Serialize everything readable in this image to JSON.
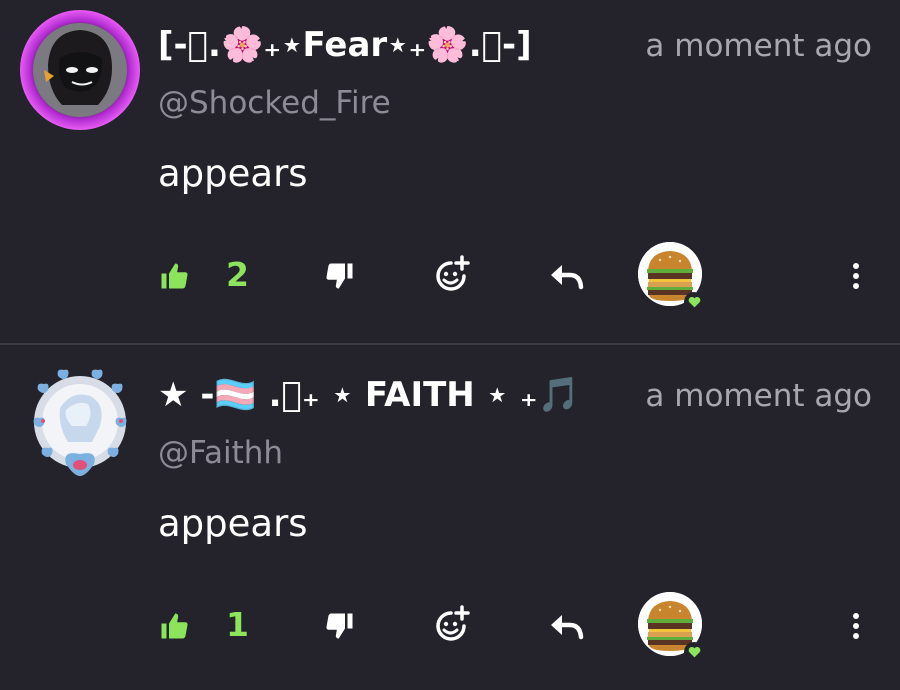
{
  "comments": [
    {
      "display_name": "[-⃟.🌸₊⋆Fear⋆₊🌸.⃟-]",
      "handle": "@Shocked_Fire",
      "timestamp": "a moment ago",
      "body": "appears",
      "like_count": "2",
      "avatar_icon": "dark-character-avatar-icon",
      "reactor_icon": "burger-avatar-icon"
    },
    {
      "display_name": "★ -🏳️‍⚧️ .⃟₊ ⋆ FAITH ⋆ ₊🎵",
      "handle": "@Faithh",
      "timestamp": "a moment ago",
      "body": "appears",
      "like_count": "1",
      "avatar_icon": "hearts-character-avatar-icon",
      "reactor_icon": "burger-avatar-icon"
    }
  ],
  "colors": {
    "background": "#24232b",
    "like_green": "#8ce35c",
    "muted_text": "#a8a7b0",
    "handle_text": "#8d8c96",
    "avatar_ring_magenta": "#d63fe8"
  },
  "icons": {
    "like": "thumbs-up-icon",
    "dislike": "thumbs-down-icon",
    "react": "add-reaction-icon",
    "reply": "reply-icon",
    "more": "more-vertical-icon",
    "heart": "heart-icon"
  }
}
